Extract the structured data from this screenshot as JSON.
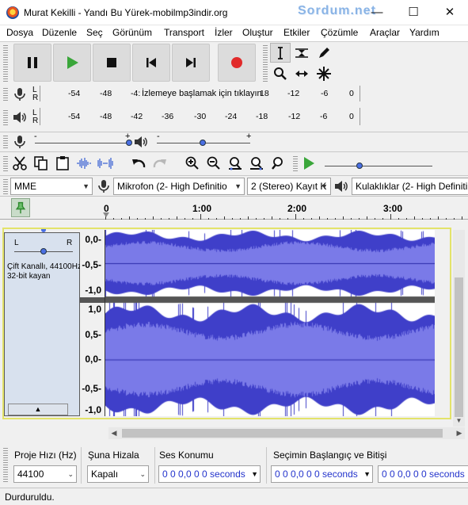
{
  "window": {
    "title": "Murat Kekilli - Yandı Bu Yürek-mobilmp3indir.org",
    "watermark": "Sordum.net",
    "minimize_glyph": "—",
    "maximize_glyph": "☐",
    "close_glyph": "✕"
  },
  "menu": [
    "Dosya",
    "Düzenle",
    "Seç",
    "Görünüm",
    "Transport",
    "İzler",
    "Oluştur",
    "Etkiler",
    "Çözümle",
    "Araçlar",
    "Yardım"
  ],
  "transport": {
    "buttons": [
      "pause-icon",
      "play-icon",
      "stop-icon",
      "skip-start-icon",
      "skip-end-icon",
      "record-icon"
    ],
    "play_color": "#3aa63a",
    "record_color": "#e12a2a"
  },
  "tools": [
    "selection-tool-icon",
    "envelope-tool-icon",
    "draw-tool-icon",
    "zoom-tool-icon",
    "timeshift-tool-icon",
    "multi-tool-icon"
  ],
  "record_meter": {
    "L": "L",
    "R": "R",
    "scale_left": [
      "-54",
      "-48",
      "-4:"
    ],
    "prompt": "İzlemeye başlamak için tıklayın",
    "scale_right": [
      "18",
      "-12",
      "-6",
      "0"
    ]
  },
  "play_meter": {
    "L": "L",
    "R": "R",
    "scale": [
      "-54",
      "-48",
      "-42",
      "-36",
      "-30",
      "-24",
      "-18",
      "-12",
      "-6",
      "0"
    ]
  },
  "mixer": {
    "rec_min": "-",
    "rec_max": "+",
    "play_min": "-",
    "play_max": "+",
    "rec_level": 1.0,
    "play_level": 0.5
  },
  "devices": {
    "host": "MME",
    "mic": "Mikrofon (2- High Definitio",
    "channels": "2 (Stereo) Kayıt K",
    "speaker": "Kulaklıklar (2- High Definiti"
  },
  "timeline": {
    "labels": [
      "0",
      "1:00",
      "2:00",
      "3:00"
    ]
  },
  "track": {
    "pan_left": "L",
    "pan_right": "R",
    "info_line1": "Çift Kanallı, 44100Hz",
    "info_line2": "32-bit kayan",
    "collapse_glyph": "▲",
    "ruler_top": [
      "0,0-",
      "-0,5-",
      "-1,0"
    ],
    "ruler_bottom": [
      "1,0",
      "0,5-",
      "0,0-",
      "-0,5-",
      "-1,0"
    ],
    "wave_color": "#3f3fc9",
    "wave_light": "#7a7ae8"
  },
  "selection": {
    "rate_label": "Proje Hızı (Hz)",
    "rate_value": "44100",
    "snap_label": "Şuna Hizala",
    "snap_value": "Kapalı",
    "pos_label": "Ses Konumu",
    "pos_value": "0 0 0,0 0 0 seconds",
    "range_label": "Seçimin Başlangıç ve Bitişi",
    "start_value": "0 0 0,0 0 0 seconds",
    "end_value": "0 0 0,0 0 0 seconds"
  },
  "status": "Durduruldu."
}
